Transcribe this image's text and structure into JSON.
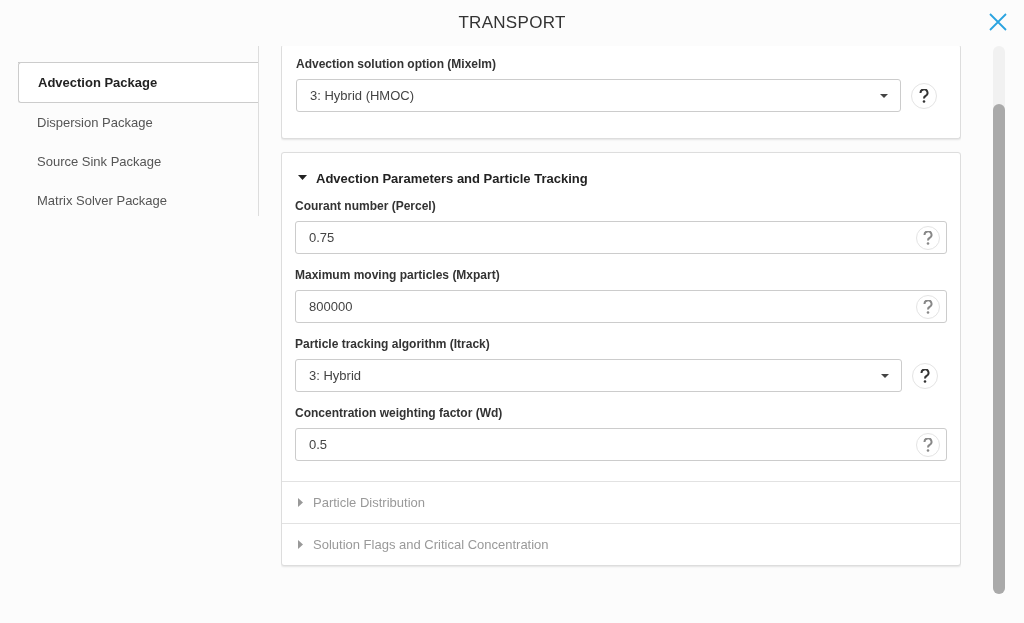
{
  "window": {
    "title": "TRANSPORT"
  },
  "sidebar": {
    "items": [
      {
        "label": "Advection Package",
        "selected": true
      },
      {
        "label": "Dispersion Package",
        "selected": false
      },
      {
        "label": "Source Sink Package",
        "selected": false
      },
      {
        "label": "Matrix Solver Package",
        "selected": false
      }
    ]
  },
  "top_card": {
    "fields": [
      {
        "kind": "select",
        "label": "Advection solution option (Mixelm)",
        "value": "3: Hybrid (HMOC)"
      }
    ]
  },
  "sections": [
    {
      "title": "Advection Parameters and Particle Tracking",
      "expanded": true,
      "fields": [
        {
          "kind": "text",
          "label": "Courant number (Percel)",
          "value": "0.75"
        },
        {
          "kind": "text",
          "label": "Maximum moving particles (Mxpart)",
          "value": "800000"
        },
        {
          "kind": "select",
          "label": "Particle tracking algorithm (Itrack)",
          "value": "3: Hybrid"
        },
        {
          "kind": "text",
          "label": "Concentration weighting factor (Wd)",
          "value": "0.5"
        }
      ]
    },
    {
      "title": "Particle Distribution",
      "expanded": false
    },
    {
      "title": "Solution Flags and Critical Concentration",
      "expanded": false
    }
  ]
}
